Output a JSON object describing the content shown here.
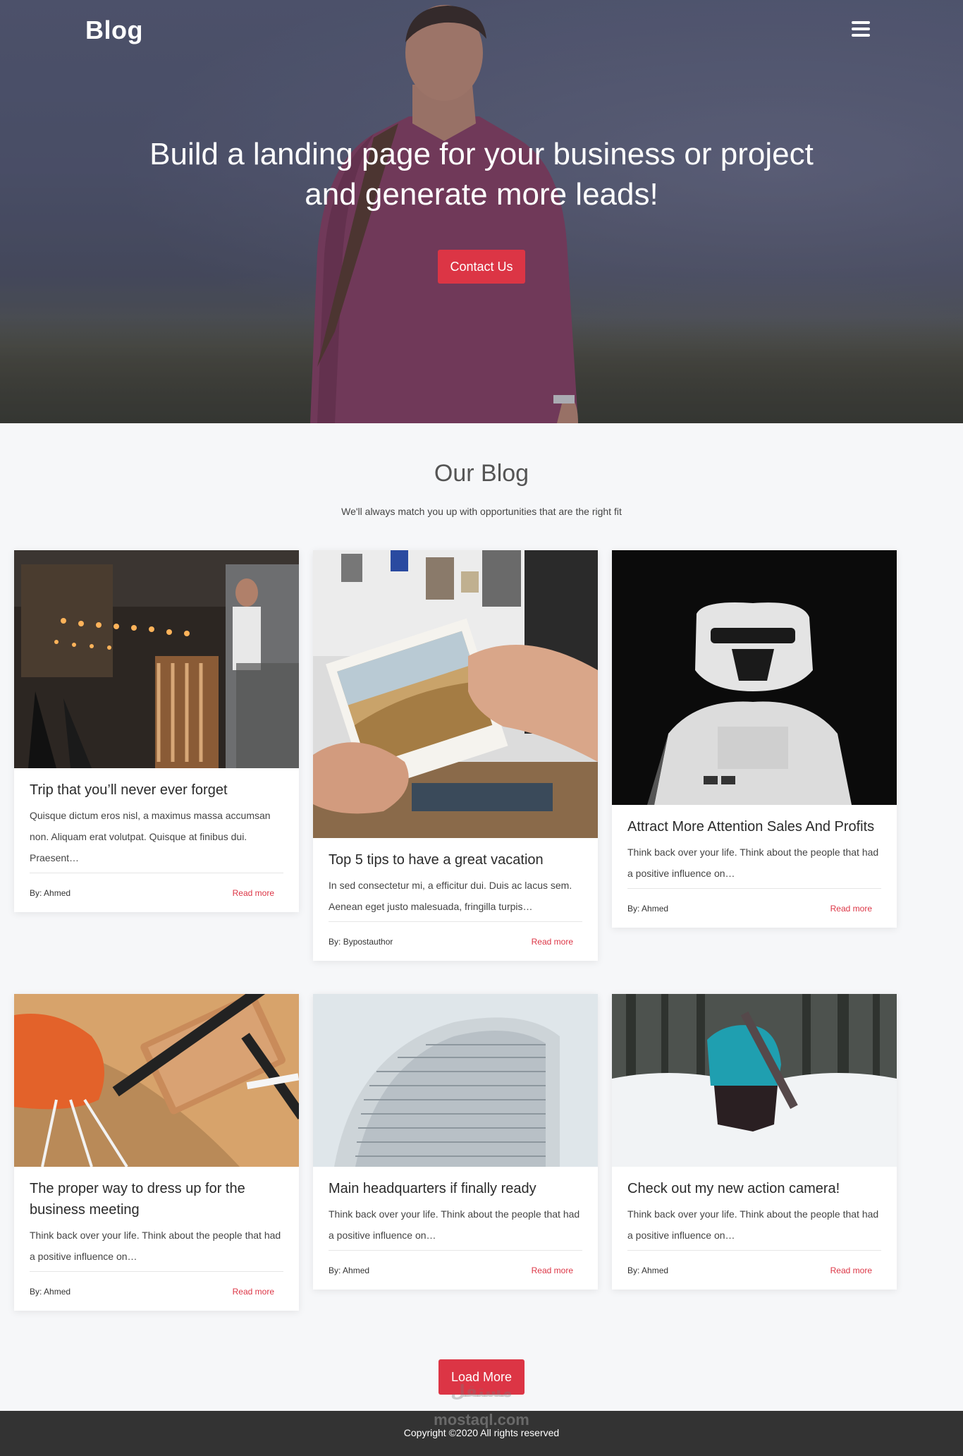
{
  "header": {
    "logo": "Blog",
    "menu_icon": "hamburger-menu-icon"
  },
  "hero": {
    "title": "Build a landing page for your business or project and generate more leads!",
    "cta_label": "Contact Us"
  },
  "blog": {
    "heading": "Our Blog",
    "subheading": "We'll always match you up with opportunities that are the right fit",
    "posts": [
      {
        "title": "Trip that you’ll never ever forget",
        "excerpt": "Quisque dictum eros nisl, a maximus massa accumsan non. Aliquam erat volutpat. Quisque at finibus dui. Praesent…",
        "by_label": "By:",
        "author": "Ahmed",
        "read_more": "Read more"
      },
      {
        "title": "Top 5 tips to have a great vacation",
        "excerpt": "In sed consectetur mi, a efficitur dui. Duis ac lacus sem. Aenean eget justo malesuada, fringilla turpis…",
        "by_label": "By:",
        "author": "Bypostauthor",
        "read_more": "Read more"
      },
      {
        "title": "Attract More Attention Sales And Profits",
        "excerpt": "Think back over your life. Think about the people that had a positive influence on…",
        "by_label": "By:",
        "author": "Ahmed",
        "read_more": "Read more"
      },
      {
        "title": "The proper way to dress up for the business meeting",
        "excerpt": "Think back over your life. Think about the people that had a positive influence on…",
        "by_label": "By:",
        "author": "Ahmed",
        "read_more": "Read more"
      },
      {
        "title": "Main headquarters if finally ready",
        "excerpt": "Think back over your life. Think about the people that had a positive influence on…",
        "by_label": "By:",
        "author": "Ahmed",
        "read_more": "Read more"
      },
      {
        "title": "Check out my new action camera!",
        "excerpt": "Think back over your life. Think about the people that had a positive influence on…",
        "by_label": "By:",
        "author": "Ahmed",
        "read_more": "Read more"
      }
    ],
    "load_more": "Load More"
  },
  "watermark": {
    "arabic": "مستقل",
    "latin": "mostaql.com"
  },
  "footer": {
    "copyright": "Copyright ©2020 All rights reserved"
  },
  "colors": {
    "accent": "#dc3545",
    "footer_bg": "#333333",
    "page_bg": "#f6f7f9"
  }
}
